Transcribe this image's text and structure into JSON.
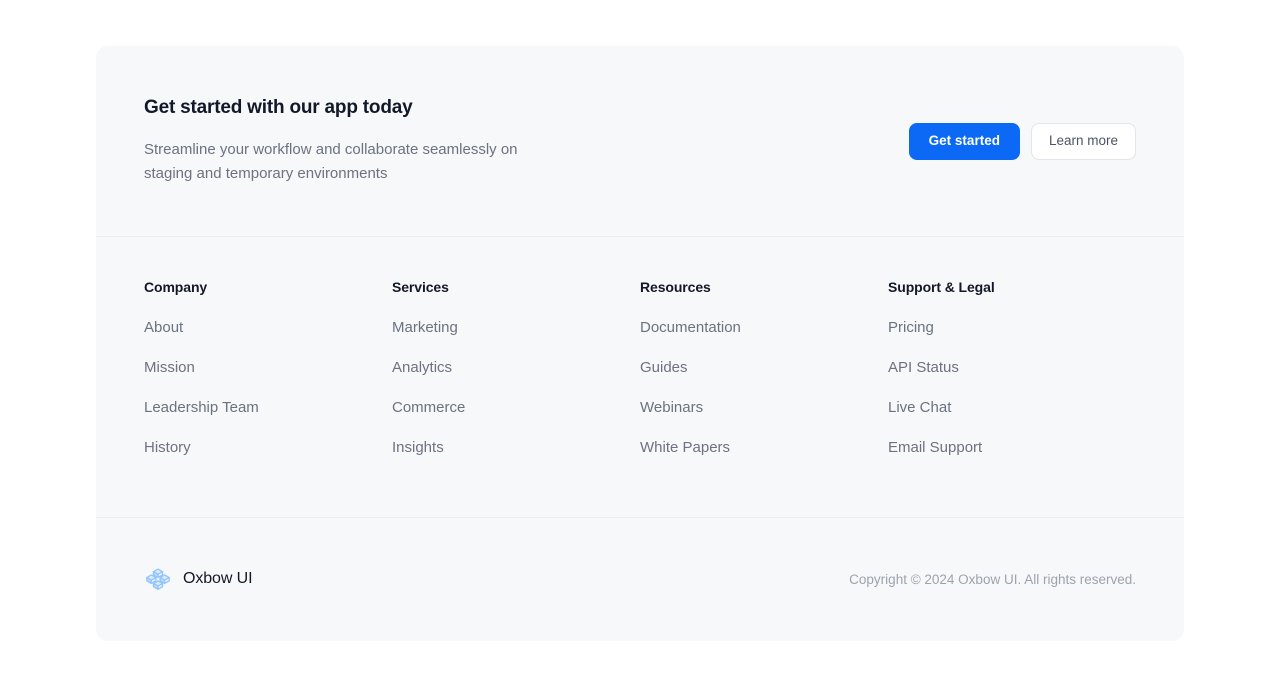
{
  "cta": {
    "title": "Get started with our app today",
    "subtitle": "Streamline your workflow and collaborate seamlessly on staging and temporary environments",
    "primary_button": "Get started",
    "secondary_button": "Learn more"
  },
  "link_columns": [
    {
      "title": "Company",
      "items": [
        "About",
        "Mission",
        "Leadership Team",
        "History"
      ]
    },
    {
      "title": "Services",
      "items": [
        "Marketing",
        "Analytics",
        "Commerce",
        "Insights"
      ]
    },
    {
      "title": "Resources",
      "items": [
        "Documentation",
        "Guides",
        "Webinars",
        "White Papers"
      ]
    },
    {
      "title": "Support & Legal",
      "items": [
        "Pricing",
        "API Status",
        "Live Chat",
        "Email Support"
      ]
    }
  ],
  "bottom": {
    "logo_icon": "isometric-cubes-logo-icon",
    "brand_name": "Oxbow UI",
    "copyright": "Copyright © 2024 Oxbow UI. All rights reserved."
  },
  "colors": {
    "card_background": "#f7f8fa",
    "page_background": "#ffffff",
    "accent_blue": "#0b69f5",
    "heading": "#111827",
    "muted_text": "#6b7280",
    "divider": "#eaecf0",
    "copyright_text": "#9ca3af",
    "logo_blue": "#93c5fd"
  }
}
